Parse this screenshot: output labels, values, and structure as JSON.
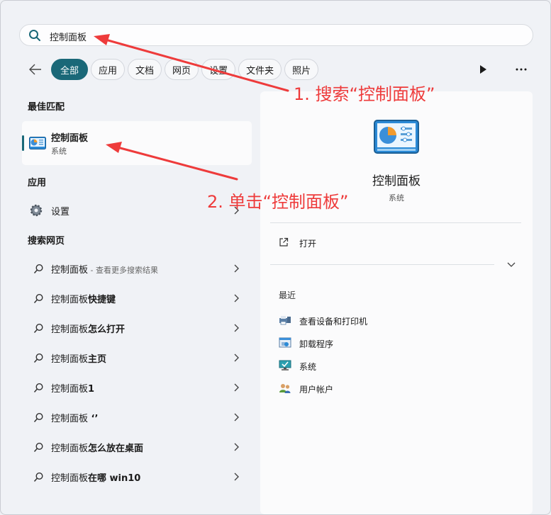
{
  "search": {
    "query": "控制面板"
  },
  "tabs": [
    "全部",
    "应用",
    "文档",
    "网页",
    "设置",
    "文件夹",
    "照片"
  ],
  "best_match": {
    "title": "最佳匹配",
    "name": "控制面板",
    "subtitle": "系统"
  },
  "apps": {
    "title": "应用",
    "items": [
      {
        "label": "设置",
        "icon": "gear-icon"
      }
    ]
  },
  "web": {
    "title": "搜索网页",
    "items": [
      {
        "prefix": "控制面板",
        "bold": "",
        "extra": " - 查看更多搜索结果"
      },
      {
        "prefix": "控制面板",
        "bold": "快捷键",
        "extra": ""
      },
      {
        "prefix": "控制面板",
        "bold": "怎么打开",
        "extra": ""
      },
      {
        "prefix": "控制面板",
        "bold": "主页",
        "extra": ""
      },
      {
        "prefix": "控制面板",
        "bold": "1",
        "extra": ""
      },
      {
        "prefix": "控制面板",
        "bold": " ‘’",
        "extra": ""
      },
      {
        "prefix": "控制面板",
        "bold": "怎么放在桌面",
        "extra": ""
      },
      {
        "prefix": "控制面板",
        "bold": "在哪 win10",
        "extra": ""
      }
    ]
  },
  "detail": {
    "title": "控制面板",
    "subtitle": "系统",
    "open_label": "打开",
    "recent_title": "最近",
    "recent": [
      {
        "label": "查看设备和打印机",
        "icon": "printer-icon"
      },
      {
        "label": "卸载程序",
        "icon": "uninstall-program-icon"
      },
      {
        "label": "系统",
        "icon": "system-monitor-icon"
      },
      {
        "label": "用户帐户",
        "icon": "user-accounts-icon"
      }
    ]
  },
  "annotations": {
    "step1": "1. 搜索“控制面板”",
    "step2": "2. 单击“控制面板”"
  },
  "colors": {
    "accent": "#1a6878",
    "annotation": "#ee3b3b"
  }
}
